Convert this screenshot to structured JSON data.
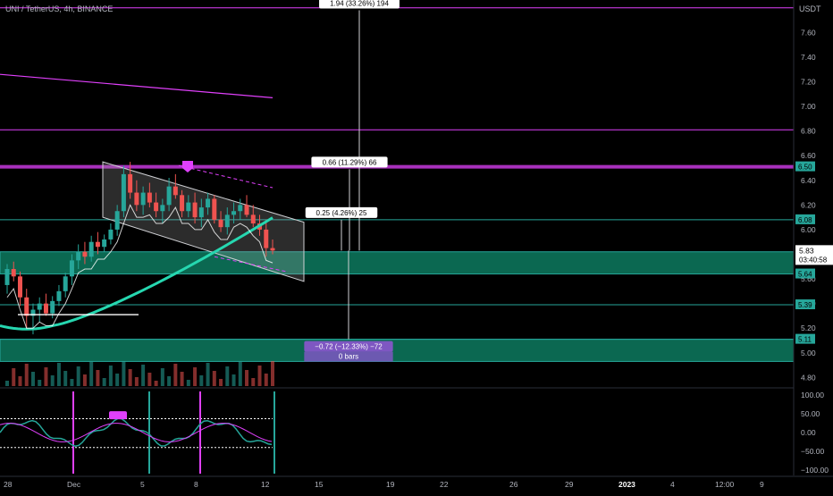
{
  "header": {
    "title": "UNI / TetherUS, 4h, BINANCE"
  },
  "colors": {
    "background": "#000000",
    "accent_teal": "#26a69a",
    "zone_teal": "#0d7a5f",
    "magenta": "#e040fb",
    "purple": "#7e57c2",
    "white": "#ffffff"
  },
  "chart_data": {
    "type": "candlestick",
    "title": "UNI / TetherUS, 4h, BINANCE",
    "currency": "USDT",
    "ylim": [
      4.73,
      7.82
    ],
    "price_ticks": [
      "7.60",
      "7.40",
      "7.20",
      "7.00",
      "6.80",
      "6.60",
      "6.40",
      "6.20",
      "6.00",
      "5.80",
      "5.60",
      "5.40",
      "5.20",
      "5.00",
      "4.80"
    ],
    "price_tick_values": [
      7.6,
      7.4,
      7.2,
      7.0,
      6.8,
      6.6,
      6.4,
      6.2,
      6.0,
      5.8,
      5.6,
      5.4,
      5.2,
      5.0,
      4.8
    ],
    "x_ticks": [
      "28",
      "Dec",
      "5",
      "8",
      "12",
      "15",
      "19",
      "22",
      "26",
      "29",
      "2023",
      "4",
      "12:00",
      "9"
    ],
    "horizontal_levels": [
      {
        "price": 7.8,
        "color": "#e040fb"
      },
      {
        "price": 6.81,
        "color": "#e040fb"
      },
      {
        "price": 6.51,
        "color": "#e040fb"
      },
      {
        "price": 6.08,
        "color": "#26a69a"
      },
      {
        "price": 5.39,
        "color": "#26a69a"
      },
      {
        "price": 5.11,
        "color": "#26a69a"
      }
    ],
    "price_tags": [
      {
        "text": "6.50",
        "price": 6.51,
        "color": "#26a69a"
      },
      {
        "text": "6.08",
        "price": 6.08,
        "color": "#26a69a"
      },
      {
        "text": "5.64",
        "price": 5.64,
        "color": "#26a69a"
      },
      {
        "text": "5.39",
        "price": 5.39,
        "color": "#26a69a"
      },
      {
        "text": "5.11",
        "price": 5.11,
        "color": "#26a69a"
      }
    ],
    "current_price": {
      "price": "5.83",
      "countdown": "03:40:58"
    },
    "zones": [
      {
        "from": 5.64,
        "to": 5.82
      },
      {
        "from": 4.93,
        "to": 5.11
      }
    ],
    "measurements": [
      {
        "text": "1.94 (33.26%) 194",
        "from": 5.83,
        "to": 7.78
      },
      {
        "text": "0.66 (11.29%) 66",
        "from": 5.83,
        "to": 6.49
      },
      {
        "text": "0.25 (4.26%) 25",
        "from": 5.83,
        "to": 6.08
      },
      {
        "text": "−0.72 (−12.33%) −72",
        "sub": "0 bars",
        "from": 5.83,
        "to": 5.11
      }
    ],
    "candles": [
      [
        5.55,
        5.72,
        5.48,
        5.68
      ],
      [
        5.68,
        5.74,
        5.58,
        5.62
      ],
      [
        5.62,
        5.66,
        5.38,
        5.45
      ],
      [
        5.45,
        5.52,
        5.2,
        5.3
      ],
      [
        5.3,
        5.4,
        5.15,
        5.35
      ],
      [
        5.35,
        5.45,
        5.25,
        5.4
      ],
      [
        5.4,
        5.48,
        5.3,
        5.32
      ],
      [
        5.32,
        5.46,
        5.28,
        5.42
      ],
      [
        5.42,
        5.55,
        5.38,
        5.5
      ],
      [
        5.5,
        5.65,
        5.45,
        5.62
      ],
      [
        5.62,
        5.8,
        5.55,
        5.75
      ],
      [
        5.75,
        5.88,
        5.68,
        5.82
      ],
      [
        5.82,
        5.9,
        5.72,
        5.78
      ],
      [
        5.78,
        5.95,
        5.74,
        5.9
      ],
      [
        5.9,
        5.98,
        5.8,
        5.86
      ],
      [
        5.86,
        5.96,
        5.82,
        5.92
      ],
      [
        5.92,
        6.05,
        5.88,
        6.0
      ],
      [
        6.0,
        6.2,
        5.95,
        6.15
      ],
      [
        6.15,
        6.52,
        6.1,
        6.45
      ],
      [
        6.45,
        6.55,
        6.25,
        6.3
      ],
      [
        6.3,
        6.4,
        6.15,
        6.2
      ],
      [
        6.2,
        6.35,
        6.12,
        6.3
      ],
      [
        6.3,
        6.38,
        6.18,
        6.22
      ],
      [
        6.22,
        6.3,
        6.1,
        6.15
      ],
      [
        6.15,
        6.25,
        6.05,
        6.2
      ],
      [
        6.2,
        6.42,
        6.15,
        6.35
      ],
      [
        6.35,
        6.45,
        6.25,
        6.28
      ],
      [
        6.28,
        6.32,
        6.1,
        6.15
      ],
      [
        6.15,
        6.28,
        6.1,
        6.22
      ],
      [
        6.22,
        6.3,
        6.05,
        6.1
      ],
      [
        6.1,
        6.25,
        6.02,
        6.18
      ],
      [
        6.18,
        6.3,
        6.12,
        6.25
      ],
      [
        6.25,
        6.28,
        6.05,
        6.08
      ],
      [
        6.08,
        6.15,
        5.98,
        6.02
      ],
      [
        6.02,
        6.18,
        5.96,
        6.12
      ],
      [
        6.12,
        6.22,
        6.05,
        6.15
      ],
      [
        6.15,
        6.25,
        6.08,
        6.2
      ],
      [
        6.2,
        6.28,
        6.1,
        6.12
      ],
      [
        6.12,
        6.2,
        6.02,
        6.05
      ],
      [
        6.05,
        6.12,
        5.95,
        6.0
      ],
      [
        6.0,
        6.08,
        5.78,
        5.85
      ],
      [
        5.85,
        5.92,
        5.8,
        5.83
      ]
    ],
    "indicator": {
      "ylim": [
        -110,
        110
      ],
      "ticks": [
        "100.00",
        "50.00",
        "0.00",
        "−50.00",
        "−100.00"
      ],
      "tick_values": [
        100,
        50,
        0,
        -50,
        -100
      ],
      "upper_band": 37,
      "lower_band": -40
    }
  }
}
